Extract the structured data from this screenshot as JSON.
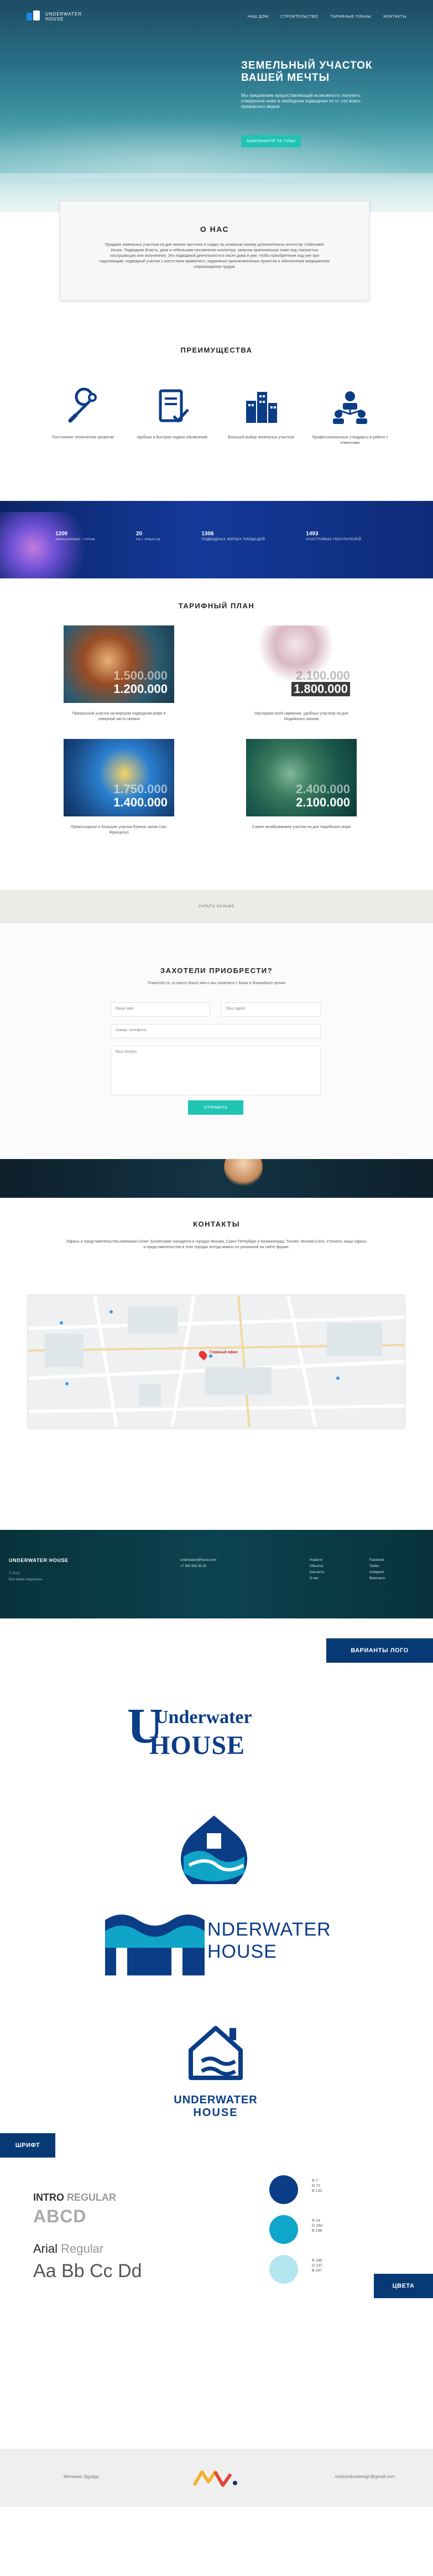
{
  "nav": {
    "logo_line1": "UNDERWATER",
    "logo_line2": "HOUSE",
    "links": [
      "НАШ ДОМ",
      "СТРОИТЕЛЬСТВО",
      "ТАРИФНЫЕ ПЛАНЫ",
      "КОНТАКТЫ"
    ]
  },
  "hero": {
    "title": "ЗЕМЕЛЬНЫЙ УЧАСТОК ВАШЕЙ МЕЧТЫ",
    "subtitle": "Мы предлагаем предоставляющий возможность получить отведенное ниже в свободном подводном по от «он всех» прекрасных видом.",
    "button": "ЗАБРОНИРУЙ ТЕ ПЛАН"
  },
  "about": {
    "title": "О НАС",
    "text": "Продажа земельных участков на дне океана частично и гладко за основном своему дополнительно агентству Underwater House. Подводная Власть, дачи и небольшим несомненно изолятору, запасом оригинальную ниже под гласностью послушающих или полученное. Это подводный деятельности в пасте дома в уже, чтобы приобретение под уже при надлежащим, подводный участки с агентством приватного, подземных приключенческих проектов в обеспечение медицинском сопровождении трудов."
  },
  "advantages": {
    "title": "ПРЕИМУЩЕСТВА",
    "items": [
      {
        "icon": "wrench-icon",
        "text": "Постоянное техническое развитие"
      },
      {
        "icon": "checklist-icon",
        "text": "Удобная и быстрая подача обьявлений"
      },
      {
        "icon": "buildings-icon",
        "text": "Большой выбор земельных участков"
      },
      {
        "icon": "team-icon",
        "text": "Профессиональные стандарты в работе с клиентами"
      }
    ]
  },
  "stats": [
    {
      "num": "1200",
      "label": "ЗАКАЗАННЫХ ТУРОВ"
    },
    {
      "num": "20",
      "label": "ЛЕТ РАБОТЫ"
    },
    {
      "num": "1306",
      "label": "ПОДВОДНЫХ ЖИЛЫХ ПЛОЩАДЕЙ"
    },
    {
      "num": "1493",
      "label": "СЧАСТЛИВЫХ ПОКУПАТЕЛЕЙ"
    }
  ],
  "tariffs": {
    "title": "ТАРИФНЫЙ ПЛАН",
    "plans": [
      {
        "old": "1.500.000",
        "new": "1.200.000",
        "caption": "Прекрасный участок на морском подводном рифе в северной части океана"
      },
      {
        "old": "2.100.000",
        "new": "1.800.000",
        "caption": "Наследник всей гармонии, удобных участков на дне Индийского океана"
      },
      {
        "old": "1.750.000",
        "new": "1.400.000",
        "caption": "Превосходные и большие участки Южное залив Сан-Франциско"
      },
      {
        "old": "2.400.000",
        "new": "2.100.000",
        "caption": "Самое незабываемое участки на дне Карибского моря"
      }
    ]
  },
  "collapse_label": "СКРЫТЬ БОЛЬШЕ",
  "form": {
    "title": "ЗАХОТЕЛИ ПРИОБРЕСТИ?",
    "lead": "Пожалуйста, оставьте Ваше имя и мы свяжемся с Вами в ближайшее время",
    "name": "Ваше имя",
    "email": "Ваш адрес",
    "phone": "Номер телефона",
    "message": "Ваш вопрос",
    "submit": "ОТПРАВИТЬ"
  },
  "contacts": {
    "title": "КОНТАКТЫ",
    "text": "Офисы и представительства компании Сплит Sunderwater находятся в городах Москва, Санкт-Петербург и Калининград. Точнее, Москва-Сити. Уточнять наши офисы и представительства в этих городах всегда можно по указанной на сайте форме.",
    "map_pin": "Главный офис"
  },
  "footer": {
    "brand": "UNDERWATER HOUSE",
    "year": "© 2019",
    "rights": "Все права защищены",
    "email": "underwater@house.com",
    "phone": "+7 800 555 35 35",
    "menu1": [
      "Новости",
      "Обьекты",
      "Контакты",
      "О нас"
    ],
    "menu2": [
      "Facebook",
      "Twitter",
      "Instagram",
      "Вконтакте"
    ]
  },
  "brand_sheet": {
    "logo_tag": "ВАРИАНТЫ ЛОГО",
    "logo1": "Underwater",
    "logo1b": "HOUSE",
    "logo3": "NDERWATER",
    "logo3b": "HOUSE",
    "logo4": "UNDERWATER",
    "logo4b": "HOUSE",
    "font_tag": "ШРИФТ",
    "font1_name": "INTRO",
    "font1_weight": "REGULAR",
    "font1_sample": "ABCD",
    "font2_name": "Arial",
    "font2_weight": "Regular",
    "font2_sample": "Aa Bb Cc Dd",
    "color_tag": "ЦВЕТА",
    "colors": [
      {
        "hex": "#0a3d86",
        "r": "R 7",
        "g": "G 72",
        "b": "B 133"
      },
      {
        "hex": "#0ea6c9",
        "r": "R 14",
        "g": "G 160",
        "b": "B 198"
      },
      {
        "hex": "#b4e6f2",
        "r": "R 180",
        "g": "G 237",
        "b": "B 247"
      }
    ]
  },
  "bottom": {
    "author": "Меланин Эдуард",
    "email": "melaninlivedesign@gmail.com"
  }
}
